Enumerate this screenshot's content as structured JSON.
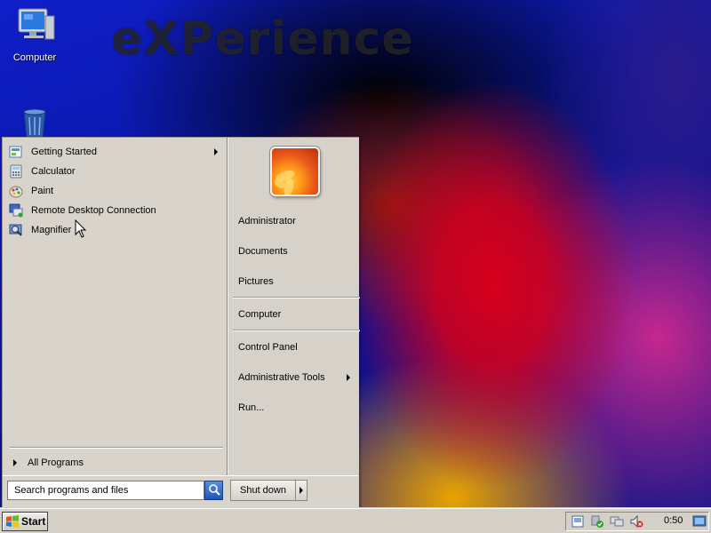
{
  "desktop": {
    "watermark": "eXPerience",
    "icons": [
      {
        "label": "Computer",
        "icon": "computer-icon"
      },
      {
        "label": "",
        "icon": "recycle-bin-icon"
      }
    ]
  },
  "start_menu": {
    "programs": [
      {
        "label": "Getting Started",
        "icon": "getting-started-icon",
        "has_submenu": true
      },
      {
        "label": "Calculator",
        "icon": "calculator-icon",
        "has_submenu": false
      },
      {
        "label": "Paint",
        "icon": "paint-icon",
        "has_submenu": false
      },
      {
        "label": "Remote Desktop Connection",
        "icon": "remote-desktop-icon",
        "has_submenu": false
      },
      {
        "label": "Magnifier",
        "icon": "magnifier-icon",
        "has_submenu": false
      }
    ],
    "all_programs": "All Programs",
    "search_placeholder": "Search programs and files",
    "shutdown_label": "Shut down",
    "right_items": [
      {
        "label": "Administrator"
      },
      {
        "label": "Documents"
      },
      {
        "label": "Pictures"
      },
      {
        "label": "Computer"
      },
      {
        "label": "Control Panel"
      },
      {
        "label": "Administrative Tools",
        "has_submenu": true
      },
      {
        "label": "Run..."
      }
    ]
  },
  "taskbar": {
    "start_label": "Start",
    "clock": "0:50",
    "tray_icons": [
      "action-center-icon",
      "security-icon",
      "network-icon",
      "volume-muted-icon",
      "show-desktop-icon"
    ]
  },
  "colors": {
    "menu_bg": "#d8d4cc",
    "taskbar_bg": "#d4d0c8",
    "search_button": "#1e56b8"
  }
}
